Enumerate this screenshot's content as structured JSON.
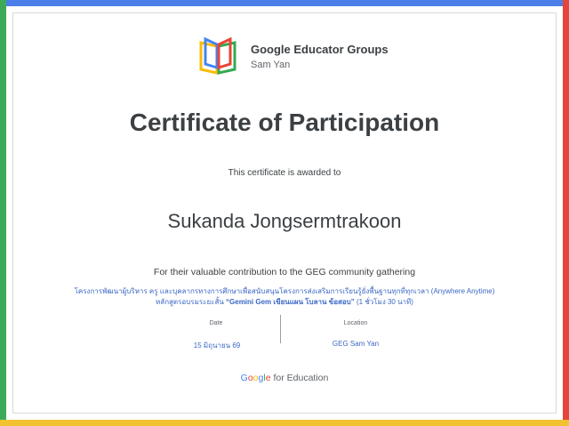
{
  "header": {
    "group_name": "Google Educator Groups",
    "chapter": "Sam Yan"
  },
  "certificate": {
    "title": "Certificate of Participation",
    "awarded_text": "This certificate is awarded to",
    "recipient": "Sukanda Jongsermtrakoon",
    "reason": "For their valuable contribution to the GEG community gathering",
    "program_line": "โครงการพัฒนาผู้บริหาร ครู และบุคลากรทางการศึกษาเพื่อสนับสนุนโครงการส่งเสริมการเรียนรู้ยั่งพื้นฐานทุกที่ทุกเวลา (Anywhere Anytime)",
    "course_prefix": "หลักสูตรอบรมระยะสั้น ",
    "course_name": "“Gemini Gem เขียนแผน โบลาน ข้อสอบ”",
    "course_suffix": " (1 ชั่วโมง 30 นาที)"
  },
  "details": {
    "date_label": "Date",
    "date_value": "15 มิถุนายน 69",
    "location_label": "Location",
    "location_value": "GEG Sam Yan"
  },
  "footer": {
    "brand_g": "G",
    "brand_o1": "o",
    "brand_o2": "o",
    "brand_g2": "g",
    "brand_l": "l",
    "brand_e": "e",
    "suffix": " for Education"
  },
  "colors": {
    "blue": "#4a7ee8",
    "green": "#3daa5a",
    "red": "#e2453c",
    "yellow": "#f2c230",
    "link": "#3b67c4"
  }
}
